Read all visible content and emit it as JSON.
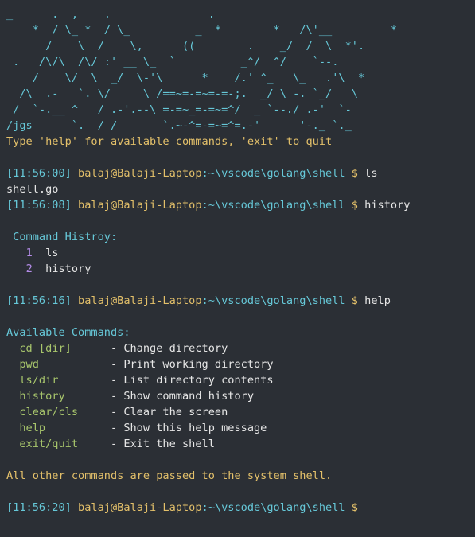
{
  "banner": {
    "lines": [
      "_      .  ,    .               .",
      "    *  / \\_ *  / \\_          _  *        *   /\\'__         *",
      "      /    \\  /    \\,      ((        .    _/  /  \\  *'.",
      " .   /\\/\\  /\\/ :' __ \\_  `          _^/  ^/    `--.",
      "    /    \\/  \\  _/  \\-'\\      *    /.' ^_   \\_   .'\\  *",
      "  /\\  .-   `. \\/     \\ /==~=-=~=-=-;.  _/ \\ -. `_/   \\",
      " /  `-.__ ^   / .-'.--\\ =-=~_=-=~=^/  _ `--./ .-'  `-",
      "/jgs      `.  / /       `.~-^=-=~=^=.-'      '-._ `._"
    ]
  },
  "welcome": "Type 'help' for available commands, 'exit' to quit",
  "prompt": {
    "user_host": "balaj@Balaji-Laptop",
    "path": ":~\\vscode\\golang\\shell",
    "dollar": " $ "
  },
  "session": {
    "cmd1": {
      "time": "[11:56:00]",
      "command": "ls",
      "output": "shell.go"
    },
    "cmd2": {
      "time": "[11:56:08]",
      "command": "history"
    },
    "history": {
      "header": " Command Histroy:",
      "items": [
        {
          "num": "1",
          "cmd": "ls"
        },
        {
          "num": "2",
          "cmd": "history"
        }
      ]
    },
    "cmd3": {
      "time": "[11:56:16]",
      "command": "help"
    },
    "help": {
      "header": "Available Commands:",
      "commands": [
        {
          "name": "  cd [dir]     ",
          "desc": " - Change directory"
        },
        {
          "name": "  pwd          ",
          "desc": " - Print working directory"
        },
        {
          "name": "  ls/dir       ",
          "desc": " - List directory contents"
        },
        {
          "name": "  history      ",
          "desc": " - Show command history"
        },
        {
          "name": "  clear/cls    ",
          "desc": " - Clear the screen"
        },
        {
          "name": "  help         ",
          "desc": " - Show this help message"
        },
        {
          "name": "  exit/quit    ",
          "desc": " - Exit the shell"
        }
      ],
      "footer": "All other commands are passed to the system shell."
    },
    "cmd4": {
      "time": "[11:56:20]",
      "command": ""
    }
  },
  "colors": {
    "background": "#2b2f35",
    "cyan": "#66c8d8",
    "yellow": "#e3c06a",
    "purple": "#b48ce8",
    "green": "#a8c66c",
    "text": "#e6e6e6"
  }
}
